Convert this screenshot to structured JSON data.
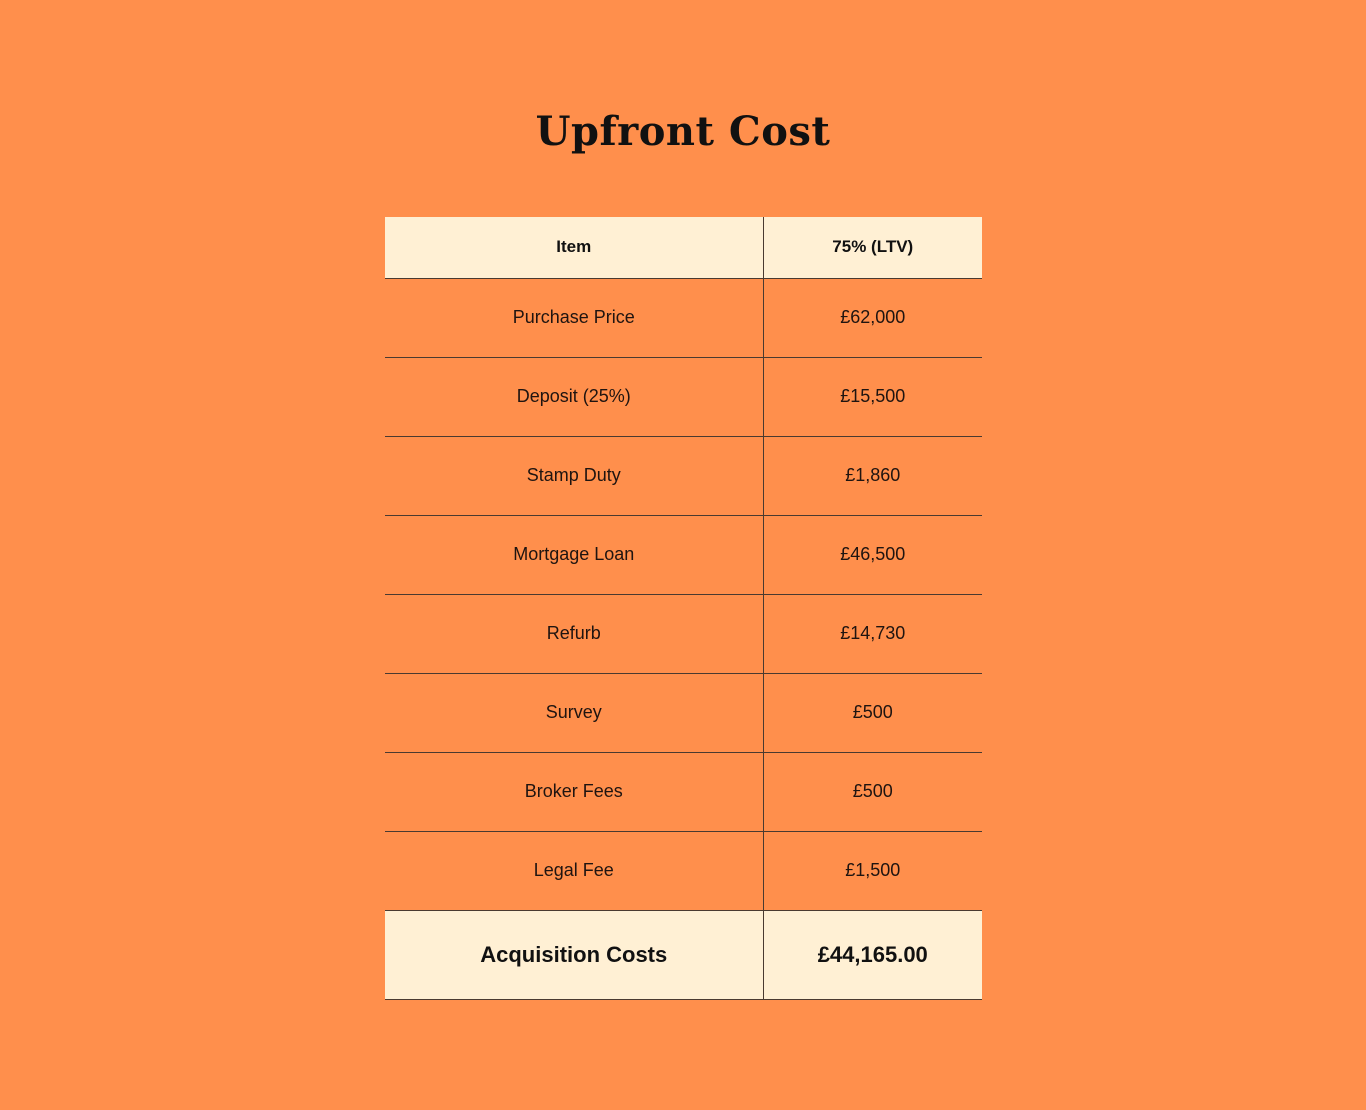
{
  "title": "Upfront Cost",
  "table": {
    "headers": [
      "Item",
      "75% (LTV)"
    ],
    "rows": [
      {
        "item": "Purchase Price",
        "value": "£62,000"
      },
      {
        "item": "Deposit (25%)",
        "value": "£15,500"
      },
      {
        "item": "Stamp Duty",
        "value": "£1,860"
      },
      {
        "item": "Mortgage Loan",
        "value": "£46,500"
      },
      {
        "item": "Refurb",
        "value": "£14,730"
      },
      {
        "item": "Survey",
        "value": "£500"
      },
      {
        "item": "Broker Fees",
        "value": "£500"
      },
      {
        "item": "Legal Fee",
        "value": "£1,500"
      }
    ],
    "total": {
      "item": "Acquisition Costs",
      "value": "£44,165.00"
    }
  },
  "colors": {
    "background": "#FF8F4C",
    "highlight_row": "#FFF0D4",
    "border": "#4a3a30"
  }
}
